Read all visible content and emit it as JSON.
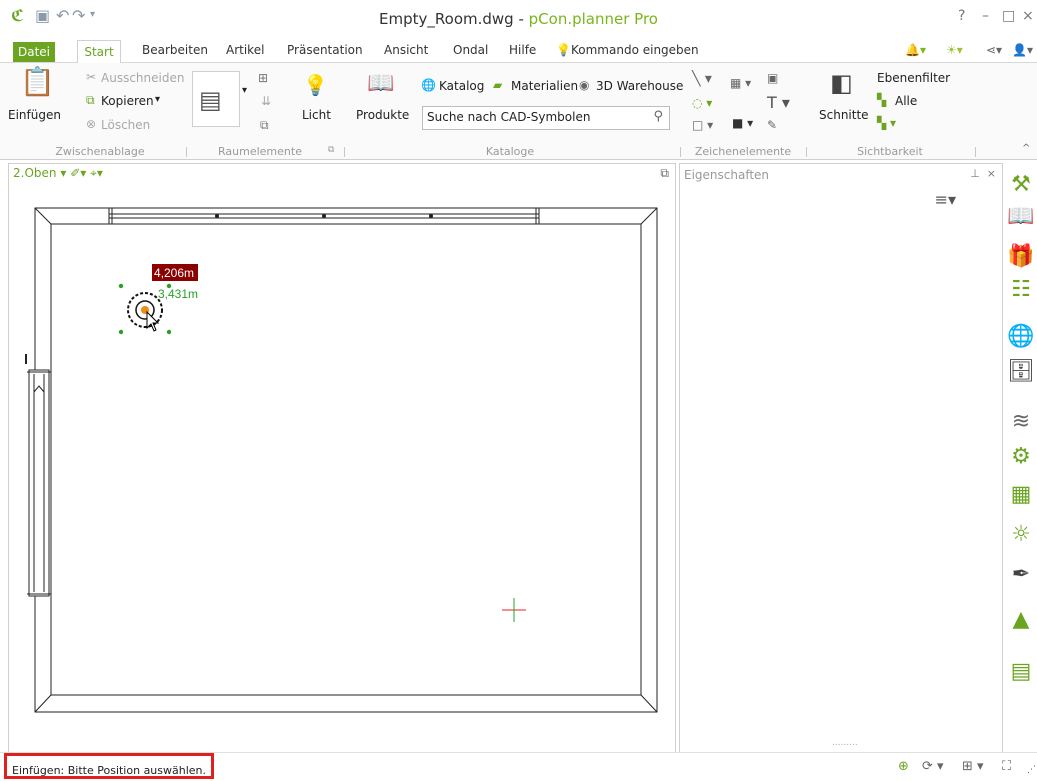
{
  "window": {
    "title_file": "Empty_Room.dwg",
    "title_sep": " - ",
    "title_app": "pCon.planner Pro",
    "help": "?",
    "minimize": "–",
    "maximize": "□",
    "close": "×"
  },
  "ribbon_tabs": [
    {
      "label": "Datei"
    },
    {
      "label": "Start"
    },
    {
      "label": "Bearbeiten"
    },
    {
      "label": "Artikel"
    },
    {
      "label": "Präsentation"
    },
    {
      "label": "Ansicht"
    },
    {
      "label": "Ondal"
    },
    {
      "label": "Hilfe"
    },
    {
      "label": "Kommando eingeben"
    }
  ],
  "clipboard": {
    "paste": "Einfügen",
    "cut": "Ausschneiden",
    "copy": "Kopieren",
    "delete": "Löschen",
    "group": "Zwischenablage"
  },
  "room": {
    "light": "Licht",
    "products": "Produkte",
    "group": "Raumelemente"
  },
  "catalogs": {
    "catalog": "Katalog",
    "materials": "Materialien",
    "warehouse": "3D Warehouse",
    "search_placeholder": "Suche nach CAD-Symbolen",
    "group": "Kataloge"
  },
  "drawing": {
    "group": "Zeichenelemente"
  },
  "visibility": {
    "sections": "Schnitte",
    "layer_filter": "Ebenenfilter",
    "all": "Alle",
    "group": "Sichtbarkeit"
  },
  "viewport": {
    "view_name": "2.Oben",
    "dim1": "4,206m",
    "dim2": "3,431m"
  },
  "properties": {
    "title": "Eigenschaften"
  },
  "status": {
    "text": "Einfügen: Bitte Position auswählen."
  },
  "colors": {
    "accent": "#6aa420",
    "highlight": "#e0201c",
    "dim_label_bg": "#8b0000"
  }
}
